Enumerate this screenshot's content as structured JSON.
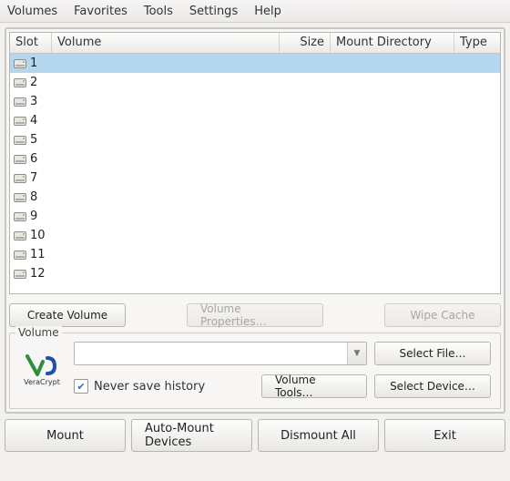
{
  "menu": {
    "volumes": "Volumes",
    "favorites": "Favorites",
    "tools": "Tools",
    "settings": "Settings",
    "help": "Help"
  },
  "columns": {
    "slot": "Slot",
    "volume": "Volume",
    "size": "Size",
    "mount": "Mount Directory",
    "type": "Type"
  },
  "slots": [
    {
      "num": "1",
      "selected": true
    },
    {
      "num": "2",
      "selected": false
    },
    {
      "num": "3",
      "selected": false
    },
    {
      "num": "4",
      "selected": false
    },
    {
      "num": "5",
      "selected": false
    },
    {
      "num": "6",
      "selected": false
    },
    {
      "num": "7",
      "selected": false
    },
    {
      "num": "8",
      "selected": false
    },
    {
      "num": "9",
      "selected": false
    },
    {
      "num": "10",
      "selected": false
    },
    {
      "num": "11",
      "selected": false
    },
    {
      "num": "12",
      "selected": false
    }
  ],
  "midButtons": {
    "createVolume": "Create Volume",
    "volumeProperties": "Volume Properties…",
    "wipeCache": "Wipe Cache"
  },
  "volumeGroup": {
    "legend": "Volume",
    "logoText": "VeraCrypt",
    "comboValue": "",
    "selectFile": "Select File…",
    "neverSave": "Never save history",
    "neverSaveChecked": true,
    "volumeTools": "Volume Tools…",
    "selectDevice": "Select Device…"
  },
  "bottomButtons": {
    "mount": "Mount",
    "autoMount": "Auto-Mount Devices",
    "dismountAll": "Dismount All",
    "exit": "Exit"
  }
}
